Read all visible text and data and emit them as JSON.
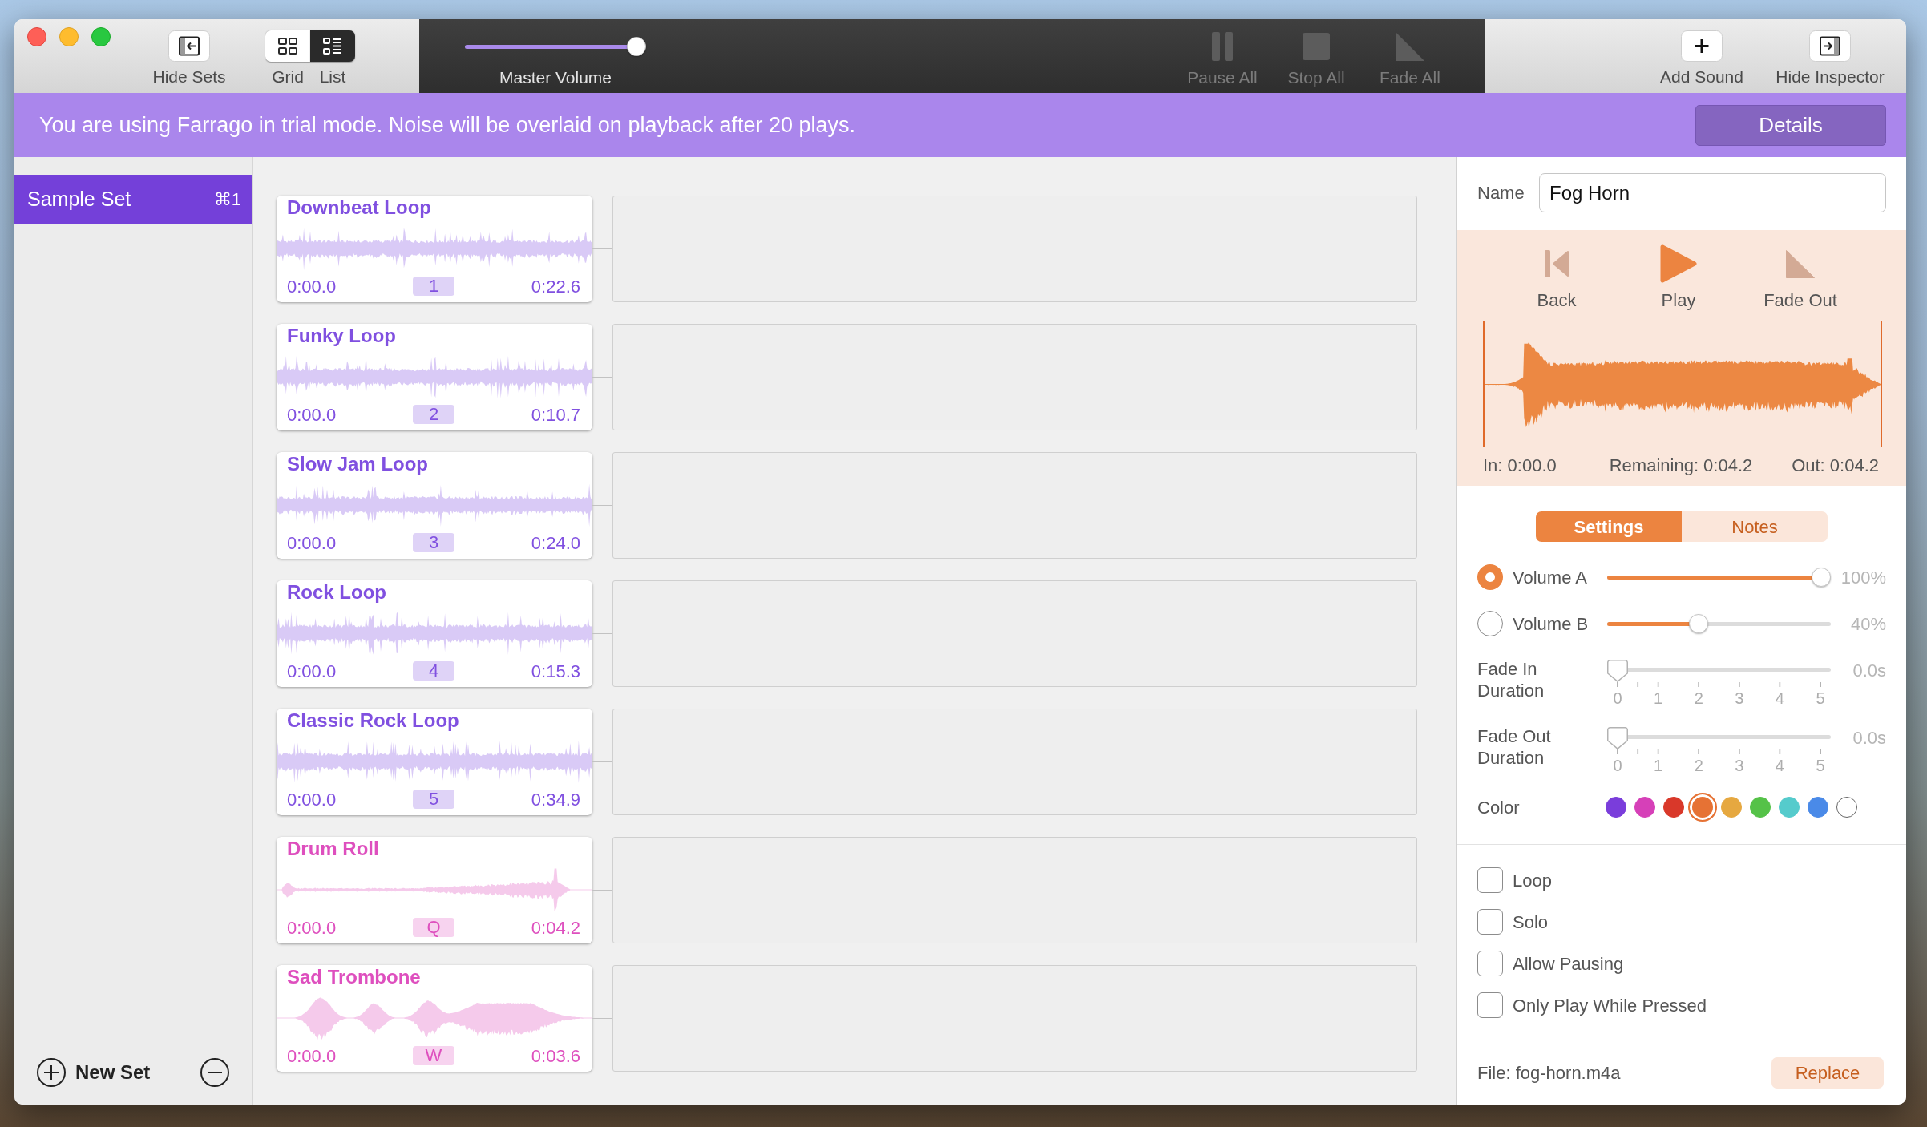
{
  "toolbar": {
    "hide_sets": {
      "label": "Hide Sets"
    },
    "view_modes": [
      {
        "label": "Grid",
        "kind": "grid",
        "selected": false
      },
      {
        "label": "List",
        "kind": "list",
        "selected": true
      }
    ],
    "master_volume": {
      "label": "Master Volume",
      "level": 1
    },
    "transport": [
      {
        "label": "Pause All",
        "kind": "pause",
        "disabled": true
      },
      {
        "label": "Stop All",
        "kind": "stop",
        "disabled": true
      },
      {
        "label": "Fade All",
        "kind": "fade",
        "disabled": true
      }
    ],
    "add_sound": {
      "label": "Add Sound"
    },
    "hide_inspector": {
      "label": "Hide Inspector"
    }
  },
  "banner": {
    "message": "You are using Farrago in trial mode. Noise will be overlaid on playback after 20 plays.",
    "button": "Details"
  },
  "sidebar": {
    "sets": [
      {
        "label": "Sample Set",
        "shortcut": "⌘1",
        "selected": true
      }
    ],
    "new_set": "New Set"
  },
  "sounds": [
    {
      "title": "Downbeat Loop",
      "kind": "loop",
      "start": "0:00.0",
      "key": "1",
      "duration": "0:22.6",
      "color": "#8050e0"
    },
    {
      "title": "Funky Loop",
      "kind": "loop",
      "start": "0:00.0",
      "key": "2",
      "duration": "0:10.7",
      "color": "#8050e0"
    },
    {
      "title": "Slow Jam Loop",
      "kind": "loop",
      "start": "0:00.0",
      "key": "3",
      "duration": "0:24.0",
      "color": "#8050e0"
    },
    {
      "title": "Rock Loop",
      "kind": "loop",
      "start": "0:00.0",
      "key": "4",
      "duration": "0:15.3",
      "color": "#8050e0"
    },
    {
      "title": "Classic Rock Loop",
      "kind": "loop",
      "start": "0:00.0",
      "key": "5",
      "duration": "0:34.9",
      "color": "#8050e0"
    },
    {
      "title": "Drum Roll",
      "kind": "roll",
      "start": "0:00.0",
      "key": "Q",
      "duration": "0:04.2",
      "color": "#de4fbe"
    },
    {
      "title": "Sad Trombone",
      "kind": "swells",
      "start": "0:00.0",
      "key": "W",
      "duration": "0:03.6",
      "color": "#de4fbe"
    }
  ],
  "inspector": {
    "name": {
      "label": "Name",
      "value": "Fog Horn"
    },
    "transport": [
      {
        "label": "Back",
        "kind": "back",
        "disabled": true
      },
      {
        "label": "Play",
        "kind": "play",
        "disabled": false
      },
      {
        "label": "Fade Out",
        "kind": "fade",
        "disabled": true
      }
    ],
    "in_point": "In: 0:00.0",
    "remaining": "Remaining: 0:04.2",
    "out_point": "Out: 0:04.2",
    "tabs": [
      {
        "label": "Settings",
        "selected": true
      },
      {
        "label": "Notes",
        "selected": false
      }
    ],
    "volumes": [
      {
        "label": "Volume A",
        "selected": true,
        "level": 1,
        "reading": "100%"
      },
      {
        "label": "Volume B",
        "selected": false,
        "level": 0.4,
        "reading": "40%"
      }
    ],
    "fades": [
      {
        "label": "Fade In Duration",
        "level": 0,
        "reading": "0.0s",
        "ticks": [
          "0",
          "1",
          "2",
          "3",
          "4",
          "5"
        ]
      },
      {
        "label": "Fade Out Duration",
        "level": 0,
        "reading": "0.0s",
        "ticks": [
          "0",
          "1",
          "2",
          "3",
          "4",
          "5"
        ]
      }
    ],
    "color": {
      "label": "Color",
      "swatches": [
        {
          "color": "#7a3ddb",
          "selected": false
        },
        {
          "color": "#d640b8",
          "selected": false
        },
        {
          "color": "#d9382a",
          "selected": false
        },
        {
          "color": "#e67234",
          "selected": true
        },
        {
          "color": "#e6a840",
          "selected": false
        },
        {
          "color": "#55c248",
          "selected": false
        },
        {
          "color": "#55cbcc",
          "selected": false
        },
        {
          "color": "#4a8ae8",
          "selected": false
        },
        {
          "color": "#ffffff",
          "selected": false
        }
      ]
    },
    "options": [
      {
        "label": "Loop",
        "checked": false
      },
      {
        "label": "Solo",
        "checked": false
      },
      {
        "label": "Allow Pausing",
        "checked": false
      },
      {
        "label": "Only Play While Pressed",
        "checked": false
      }
    ],
    "file": "File: fog-horn.m4a",
    "replace": "Replace"
  }
}
